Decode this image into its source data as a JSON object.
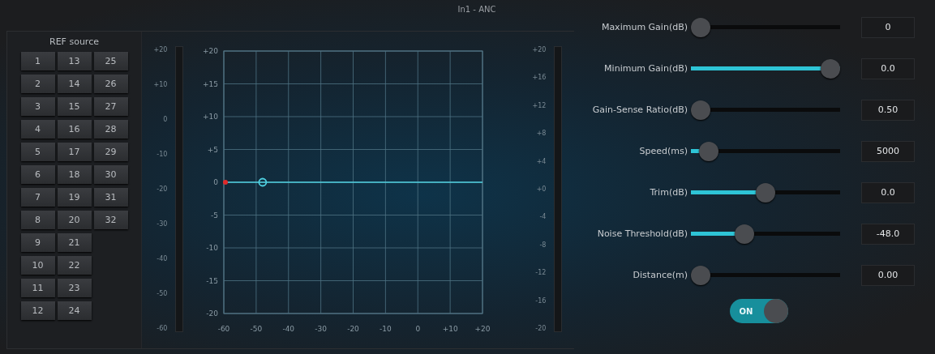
{
  "window": {
    "title": "In1 - ANC"
  },
  "ref_source": {
    "title": "REF source",
    "buttons": [
      {
        "label": "1",
        "selected": false
      },
      {
        "label": "2",
        "selected": false
      },
      {
        "label": "3",
        "selected": false
      },
      {
        "label": "4",
        "selected": false
      },
      {
        "label": "5",
        "selected": false
      },
      {
        "label": "6",
        "selected": false
      },
      {
        "label": "7",
        "selected": false
      },
      {
        "label": "8",
        "selected": false
      },
      {
        "label": "9",
        "selected": false
      },
      {
        "label": "10",
        "selected": false
      },
      {
        "label": "11",
        "selected": false
      },
      {
        "label": "12",
        "selected": false
      },
      {
        "label": "13",
        "selected": false
      },
      {
        "label": "14",
        "selected": false
      },
      {
        "label": "15",
        "selected": false
      },
      {
        "label": "16",
        "selected": false
      },
      {
        "label": "17",
        "selected": false
      },
      {
        "label": "18",
        "selected": false
      },
      {
        "label": "19",
        "selected": false
      },
      {
        "label": "20",
        "selected": false
      },
      {
        "label": "21",
        "selected": false
      },
      {
        "label": "22",
        "selected": false
      },
      {
        "label": "23",
        "selected": false
      },
      {
        "label": "24",
        "selected": false
      },
      {
        "label": "25",
        "selected": false
      },
      {
        "label": "26",
        "selected": false
      },
      {
        "label": "27",
        "selected": false
      },
      {
        "label": "28",
        "selected": false
      },
      {
        "label": "29",
        "selected": false
      },
      {
        "label": "30",
        "selected": false
      },
      {
        "label": "31",
        "selected": false
      },
      {
        "label": "32",
        "selected": false
      }
    ]
  },
  "input_meter": {
    "scale": [
      "+20",
      "+10",
      "0",
      "-10",
      "-20",
      "-30",
      "-40",
      "-50",
      "-60"
    ]
  },
  "curve": {
    "chart_data": {
      "type": "line",
      "x": [
        -60,
        -48,
        20
      ],
      "series": [
        {
          "color": "#4fd0e0",
          "values": [
            0,
            0,
            0
          ]
        }
      ],
      "grid": true,
      "xlim": [
        -60,
        20
      ],
      "ylim": [
        -20,
        20
      ],
      "xticks": [
        -60,
        -50,
        -40,
        -30,
        -20,
        -10,
        0,
        {
          "value": 10,
          "label": "+10"
        },
        {
          "value": 20,
          "label": "+20"
        }
      ],
      "yticks": [
        {
          "value": 20,
          "label": "+20"
        },
        {
          "value": 15,
          "label": "+15"
        },
        {
          "value": 10,
          "label": "+10"
        },
        {
          "value": 5,
          "label": "+5"
        },
        0,
        -5,
        -10,
        -15,
        -20
      ]
    }
  },
  "output_meter": {
    "scale": [
      "+20",
      "+16",
      "+12",
      "+8",
      "+4",
      "+0",
      "-4",
      "-8",
      "-12",
      "-16",
      "-20"
    ]
  },
  "controls": [
    {
      "label": "Maximum Gain(dB)",
      "level": 0,
      "value": "0"
    },
    {
      "label": "Minimum Gain(dB)",
      "level": 1,
      "value": "0.0"
    },
    {
      "label": "Gain-Sense Ratio(dB)",
      "level": 0,
      "value": "0.50"
    },
    {
      "label": "Speed(ms)",
      "level": 0.06,
      "value": "5000"
    },
    {
      "label": "Trim(dB)",
      "level": 0.5,
      "value": "0.0"
    },
    {
      "label": "Noise Threshold(dB)",
      "level": 0.34,
      "value": "-48.0"
    },
    {
      "label": "Distance(m)",
      "level": 0,
      "value": "0.00"
    }
  ],
  "power_toggle": {
    "label": "ON",
    "on": true
  }
}
